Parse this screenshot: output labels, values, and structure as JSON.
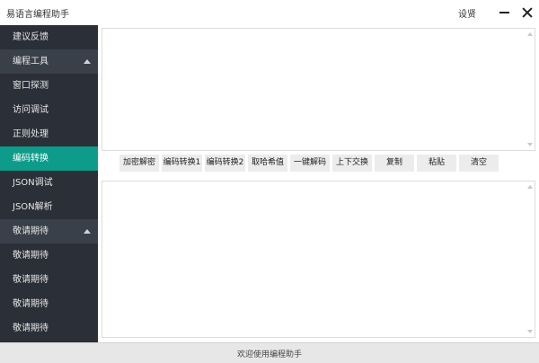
{
  "window": {
    "title": "易语言编程助手",
    "settings_label": "设贤"
  },
  "sidebar": {
    "items": [
      {
        "label": "建议反馈",
        "type": "item"
      },
      {
        "label": "编程工具",
        "type": "group"
      },
      {
        "label": "窗口探测",
        "type": "item"
      },
      {
        "label": "访问调试",
        "type": "item"
      },
      {
        "label": "正则处理",
        "type": "item"
      },
      {
        "label": "编码转换",
        "type": "item",
        "active": true
      },
      {
        "label": "JSON调试",
        "type": "item"
      },
      {
        "label": "JSON解析",
        "type": "item"
      },
      {
        "label": "敬请期待",
        "type": "group"
      },
      {
        "label": "敬请期待",
        "type": "item"
      },
      {
        "label": "敬请期待",
        "type": "item"
      },
      {
        "label": "敬请期待",
        "type": "item"
      },
      {
        "label": "敬请期待",
        "type": "item"
      }
    ]
  },
  "toolbar": {
    "buttons": [
      "加密解密",
      "编码转换1",
      "编码转换2",
      "取哈希值",
      "一键解码",
      "上下交换",
      "复制",
      "粘贴",
      "清空"
    ]
  },
  "editors": {
    "top_value": "",
    "bottom_value": ""
  },
  "status": {
    "text": "欢迎使用编程助手"
  },
  "colors": {
    "sidebar_bg": "#2b2f38",
    "group_bg": "#394049",
    "active_bg": "#0d9b8a"
  }
}
